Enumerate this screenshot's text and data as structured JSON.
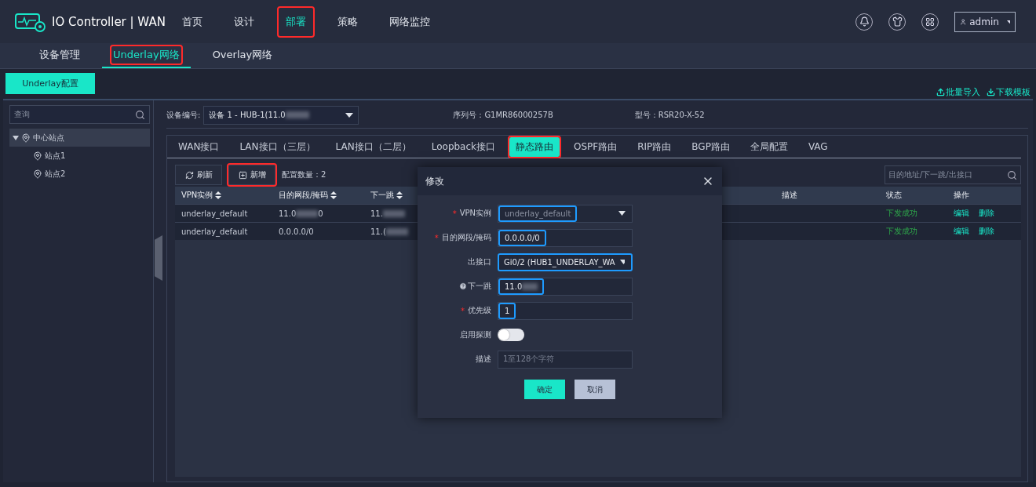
{
  "app": {
    "title": "IO Controller | WAN"
  },
  "nav": [
    {
      "label": "首页",
      "selected": false,
      "annotated": false
    },
    {
      "label": "设计",
      "selected": false,
      "annotated": false
    },
    {
      "label": "部署",
      "selected": true,
      "annotated": true
    },
    {
      "label": "策略",
      "selected": false,
      "annotated": false
    },
    {
      "label": "网络监控",
      "selected": false,
      "annotated": false
    }
  ],
  "user": {
    "name": "admin"
  },
  "subnav": [
    {
      "label": "设备管理",
      "selected": false,
      "annotated": false
    },
    {
      "label": "Underlay网络",
      "selected": true,
      "annotated": true
    },
    {
      "label": "Overlay网络",
      "selected": false,
      "annotated": false
    }
  ],
  "config_button": "Underlay配置",
  "actions": [
    {
      "label": "批量导入",
      "kind": "upload"
    },
    {
      "label": "下载模板",
      "kind": "download"
    }
  ],
  "sidebar": {
    "search_placeholder": "查询",
    "tree": [
      {
        "label": "中心站点",
        "expanded": true,
        "selected": true,
        "children": [
          {
            "label": "站点1",
            "selected": false
          },
          {
            "label": "站点2",
            "selected": false
          }
        ]
      }
    ]
  },
  "device": {
    "label": "设备编号:",
    "value": "设备 1 - HUB-1(11.0",
    "value_blurred": true,
    "serial": "序列号：G1MR86000257B",
    "model": "型号：RSR20-X-52"
  },
  "tabs": [
    {
      "label": "WAN接口",
      "selected": false,
      "annotated": false
    },
    {
      "label": "LAN接口（三层）",
      "selected": false,
      "annotated": false
    },
    {
      "label": "LAN接口（二层）",
      "selected": false,
      "annotated": false
    },
    {
      "label": "Loopback接口",
      "selected": false,
      "annotated": false
    },
    {
      "label": "静态路由",
      "selected": true,
      "annotated": true
    },
    {
      "label": "OSPF路由",
      "selected": false,
      "annotated": false
    },
    {
      "label": "RIP路由",
      "selected": false,
      "annotated": false
    },
    {
      "label": "BGP路由",
      "selected": false,
      "annotated": false
    },
    {
      "label": "全局配置",
      "selected": false,
      "annotated": false
    },
    {
      "label": "VAG",
      "selected": false,
      "annotated": false
    }
  ],
  "toolbar": {
    "buttons": [
      {
        "label": "刷新",
        "kind": "refresh",
        "annotated": false
      },
      {
        "label": "新增",
        "kind": "add",
        "annotated": true
      }
    ],
    "count": "配置数量：2",
    "search_placeholder": "目的地址/下一跳/出接口"
  },
  "table": {
    "columns": [
      {
        "label": "VPN实例",
        "sortable": true
      },
      {
        "label": "目的网段/掩码",
        "sortable": true
      },
      {
        "label": "下一跳",
        "sortable": true
      },
      {
        "label": "描述",
        "sortable": false
      },
      {
        "label": "状态",
        "sortable": false
      },
      {
        "label": "操作",
        "sortable": false
      }
    ],
    "rows": [
      {
        "cells": [
          {
            "text": "underlay_default",
            "blurred": false
          },
          {
            "text": "11.0",
            "blurred": true,
            "after": "0"
          },
          {
            "text": "11.",
            "blurred": true
          }
        ],
        "status": "下发成功",
        "actions": [
          "编辑",
          "删除"
        ]
      },
      {
        "cells": [
          {
            "text": "underlay_default",
            "blurred": false
          },
          {
            "text": "0.0.0.0/0",
            "blurred": false
          },
          {
            "text": "11.(",
            "blurred": true
          }
        ],
        "status": "下发成功",
        "actions": [
          "编辑",
          "删除"
        ]
      }
    ]
  },
  "modal": {
    "title": "修改",
    "fields": [
      {
        "label": "VPN实例",
        "required_mark": "*",
        "kind": "select",
        "value": "underlay_default",
        "disabled": true,
        "value_outlined": true,
        "field_outlined": false
      },
      {
        "label": "目的网段/掩码",
        "required_mark": "*",
        "kind": "input",
        "value": "0.0.0.0/0",
        "disabled": false,
        "value_outlined": true,
        "field_outlined": false
      },
      {
        "label": "出接口",
        "kind": "select",
        "value": "Gi0/2 (HUB1_UNDERLAY_WA",
        "disabled": false,
        "value_outlined": false,
        "field_outlined": true
      },
      {
        "label": "下一跳",
        "help": true,
        "kind": "input",
        "value": "11.0",
        "blurred": true,
        "disabled": false,
        "value_outlined": true,
        "field_outlined": false
      },
      {
        "label": "优先级",
        "required_mark": "*",
        "kind": "input",
        "value": "1",
        "disabled": false,
        "value_outlined": true,
        "field_outlined": false
      },
      {
        "label": "启用探测",
        "kind": "switch",
        "on": false
      },
      {
        "label": "描述",
        "kind": "input",
        "placeholder": "1至128个字符"
      }
    ],
    "buttons": [
      {
        "label": "确定",
        "kind": "primary"
      },
      {
        "label": "取消",
        "kind": "secondary"
      }
    ]
  }
}
